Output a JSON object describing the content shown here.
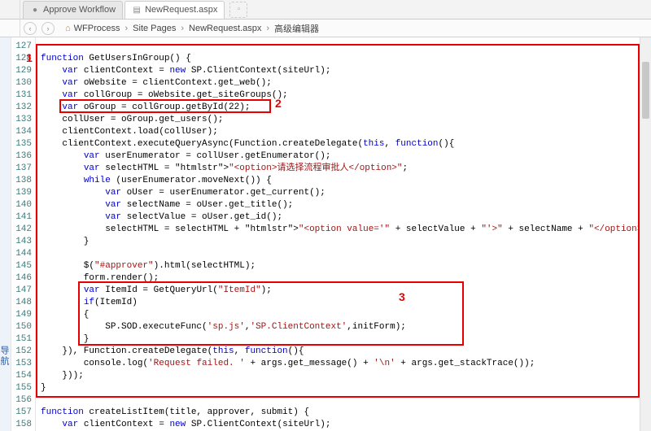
{
  "tabs": [
    {
      "label": "Approve Workflow",
      "icon": "●"
    },
    {
      "label": "NewRequest.aspx",
      "icon": "▤"
    }
  ],
  "breadcrumb": {
    "back_icon": "‹",
    "fwd_icon": "›",
    "home_icon": "⌂",
    "segments": [
      "WFProcess",
      "Site Pages",
      "NewRequest.aspx",
      "高级编辑器"
    ],
    "sep": "›"
  },
  "sidebar_label": "导航",
  "first_line": 127,
  "annotations": {
    "a1": "1",
    "a2": "2",
    "a3": "3"
  },
  "code_lines": [
    "",
    "function GetUsersInGroup() {",
    "    var clientContext = new SP.ClientContext(siteUrl);",
    "    var oWebsite = clientContext.get_web();",
    "    var collGroup = oWebsite.get_siteGroups();",
    "    var oGroup = collGroup.getById(22);",
    "    collUser = oGroup.get_users();",
    "    clientContext.load(collUser);",
    "    clientContext.executeQueryAsync(Function.createDelegate(this, function(){",
    "        var userEnumerator = collUser.getEnumerator();",
    "        var selectHTML = \"<option>请选择流程审批人</option>\";",
    "        while (userEnumerator.moveNext()) {",
    "            var oUser = userEnumerator.get_current();",
    "            var selectName = oUser.get_title();",
    "            var selectValue = oUser.get_id();",
    "            selectHTML = selectHTML + \"<option value='\" + selectValue + \"'>\" + selectName + \"</option>\";",
    "        }",
    "        ",
    "        $(\"#approver\").html(selectHTML);",
    "        form.render();",
    "        var ItemId = GetQueryUrl(\"ItemId\");",
    "        if(ItemId)",
    "        {",
    "            SP.SOD.executeFunc('sp.js','SP.ClientContext',initForm);",
    "        }",
    "    }), Function.createDelegate(this, function(){",
    "        console.log('Request failed. ' + args.get_message() + '\\n' + args.get_stackTrace());",
    "    }));",
    "}",
    "",
    "function createListItem(title, approver, submit) {",
    "    var clientContext = new SP.ClientContext(siteUrl);"
  ]
}
